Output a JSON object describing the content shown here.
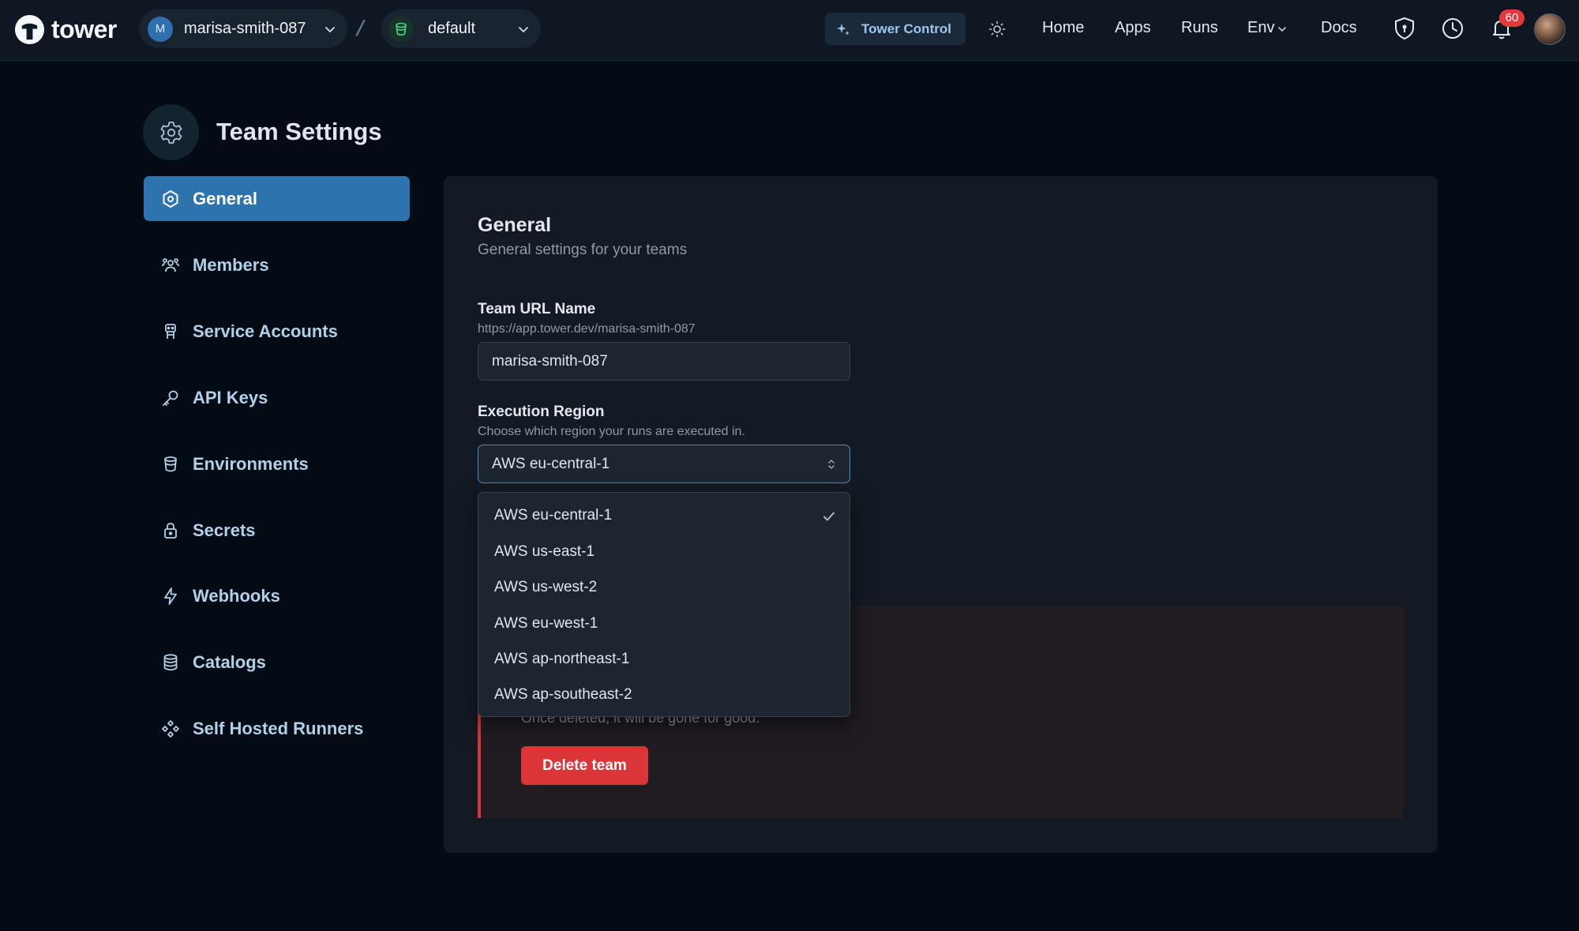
{
  "header": {
    "logo_text": "tower",
    "team": {
      "initial": "M",
      "name": "marisa-smith-087"
    },
    "environment": {
      "name": "default"
    },
    "tower_control_label": "Tower Control",
    "nav": [
      {
        "label": "Home"
      },
      {
        "label": "Apps"
      },
      {
        "label": "Runs"
      },
      {
        "label": "Env"
      },
      {
        "label": "Docs"
      }
    ],
    "notifications_count": "60"
  },
  "page": {
    "title": "Team Settings"
  },
  "sidebar": {
    "active": "General",
    "items": [
      {
        "label": "General",
        "icon": "hexagon-settings-icon"
      },
      {
        "label": "Members",
        "icon": "members-icon"
      },
      {
        "label": "Service Accounts",
        "icon": "robot-icon"
      },
      {
        "label": "API Keys",
        "icon": "key-icon"
      },
      {
        "label": "Environments",
        "icon": "cylinder-icon"
      },
      {
        "label": "Secrets",
        "icon": "lock-icon"
      },
      {
        "label": "Webhooks",
        "icon": "lightning-icon"
      },
      {
        "label": "Catalogs",
        "icon": "database-icon"
      },
      {
        "label": "Self Hosted Runners",
        "icon": "runners-icon"
      }
    ]
  },
  "general": {
    "title": "General",
    "description": "General settings for your teams",
    "team_url": {
      "label": "Team URL Name",
      "help": "https://app.tower.dev/marisa-smith-087",
      "value": "marisa-smith-087"
    },
    "region": {
      "label": "Execution Region",
      "help": "Choose which region your runs are executed in.",
      "selected": "AWS eu-central-1",
      "options": [
        "AWS eu-central-1",
        "AWS us-east-1",
        "AWS us-west-2",
        "AWS eu-west-1",
        "AWS ap-northeast-1",
        "AWS ap-southeast-2"
      ]
    }
  },
  "danger_zone": {
    "description": "Once deleted, it will be gone for good.",
    "delete_button": "Delete team"
  },
  "colors": {
    "background": "#030b14",
    "topbar": "#0f1723",
    "accent": "#2d73ae",
    "danger": "#dc3539",
    "panel": "#131a23"
  }
}
